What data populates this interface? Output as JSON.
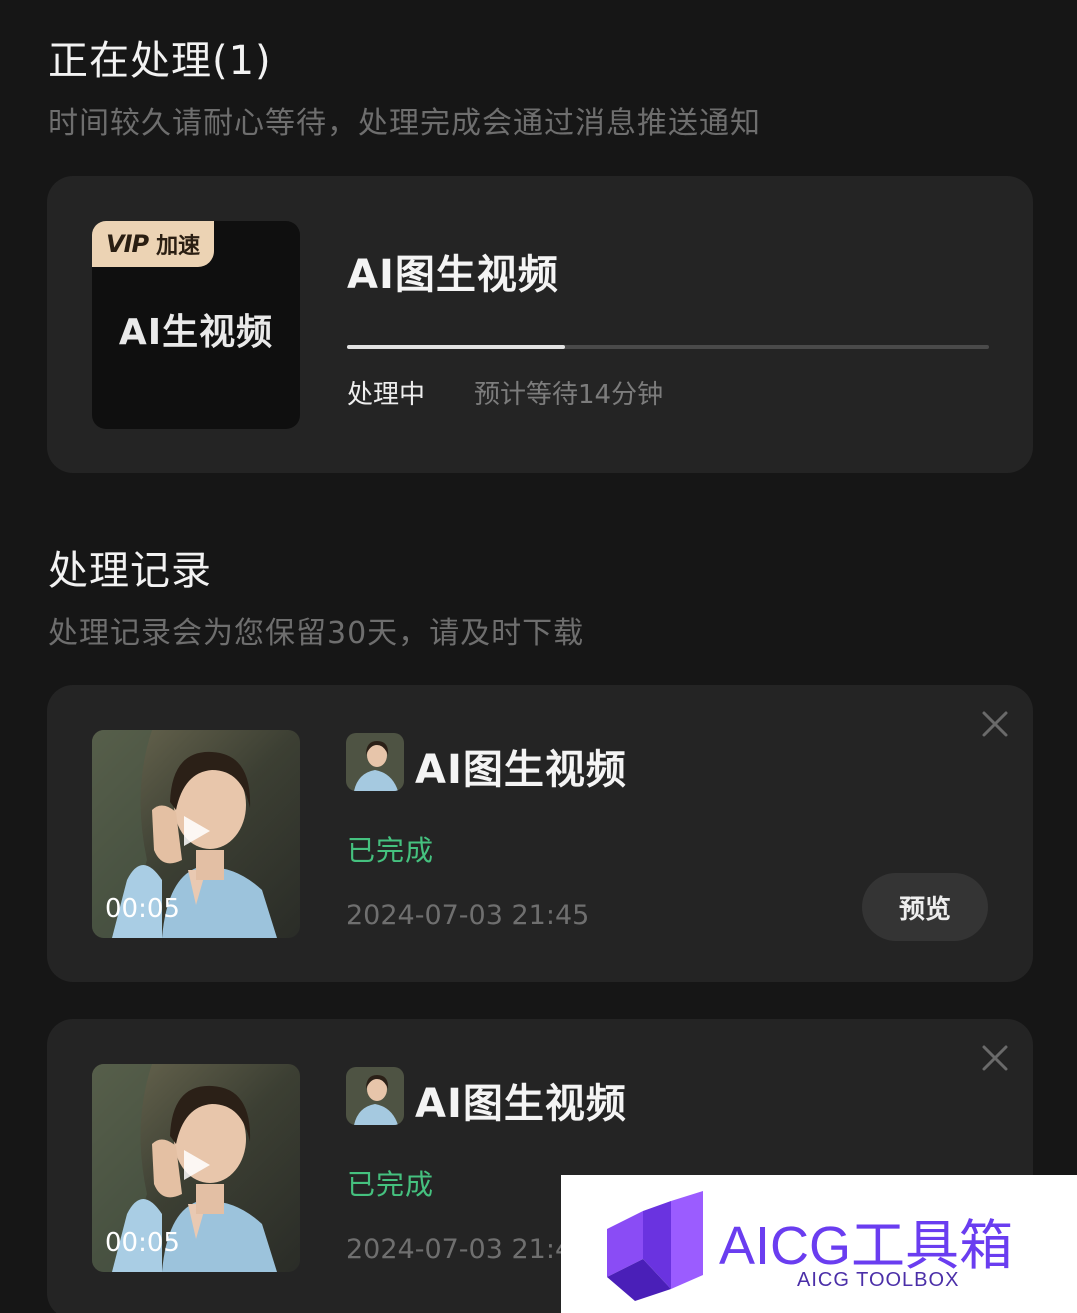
{
  "processing": {
    "title": "正在处理(1)",
    "subtitle": "时间较久请耐心等待，处理完成会通过消息推送通知",
    "item": {
      "vip_badge_vip": "VIP",
      "vip_badge_text": "加速",
      "thumb_title": "AI生视频",
      "title": "AI图生视频",
      "progress": 0.34,
      "status": "处理中",
      "eta": "预计等待14分钟"
    }
  },
  "records": {
    "title": "处理记录",
    "subtitle": "处理记录会为您保留30天，请及时下载",
    "items": [
      {
        "title": "AI图生视频",
        "status": "已完成",
        "datetime": "2024-07-03 21:45",
        "duration": "00:05",
        "preview_label": "预览"
      },
      {
        "title": "AI图生视频",
        "status": "已完成",
        "datetime": "2024-07-03 21:4",
        "duration": "00:05"
      }
    ]
  },
  "watermark": {
    "title": "AICG工具箱",
    "subtitle": "AICG TOOLBOX"
  },
  "colors": {
    "background": "#161616",
    "card": "#242424",
    "success": "#45c17f",
    "vip_badge": "#ecd3b4",
    "watermark_accent": "#6a3df0"
  },
  "icons": [
    "play-icon",
    "close-icon",
    "vip-badge",
    "aicg-logo-icon"
  ]
}
